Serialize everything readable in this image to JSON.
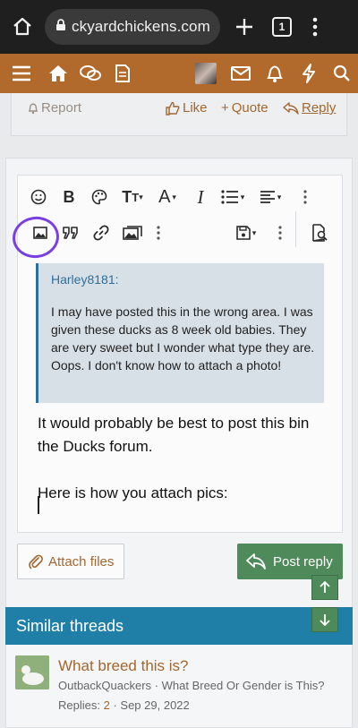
{
  "browser": {
    "url": "ckyardchickens.com",
    "tab_count": "1"
  },
  "post_actions": {
    "report": "Report",
    "like": "Like",
    "quote": "Quote",
    "reply": "Reply"
  },
  "editor": {
    "quote_author": "Harley8181:",
    "quote_lines": [
      "I may have posted this in the wrong area. I was given these ducks as 8 week old babies. They are very sweet but I wonder what type they are.",
      "Oops. I don't know how to attach a photo!"
    ],
    "reply_lines": [
      "It would probably be best to post this bin the Ducks forum.",
      "",
      "Here is how you attach pics:"
    ],
    "toolbar_icons": [
      "smile-icon",
      "bold-icon",
      "palette-icon",
      "font-size-icon",
      "text-color-icon",
      "italic-icon",
      "list-icon",
      "align-icon",
      "more-icon",
      "image-icon",
      "quote-icon",
      "link-icon",
      "media-icon",
      "more-icon",
      "save-draft-icon",
      "more-icon",
      "preview-icon"
    ]
  },
  "buttons": {
    "attach": "Attach files",
    "post_reply": "Post reply"
  },
  "similar": {
    "header": "Similar threads",
    "thread_title": "What breed this is?",
    "thread_author": "OutbackQuackers",
    "thread_forum": "What Breed Or Gender is This?",
    "replies_label": "Replies:",
    "replies_count": "2",
    "date": "Sep 29, 2022"
  },
  "colors": {
    "brand": "#b26a2c",
    "link": "#a3672f",
    "post_button": "#4e8a5a",
    "similar_header": "#1f7fa7",
    "annotation": "#7a3fe0"
  }
}
